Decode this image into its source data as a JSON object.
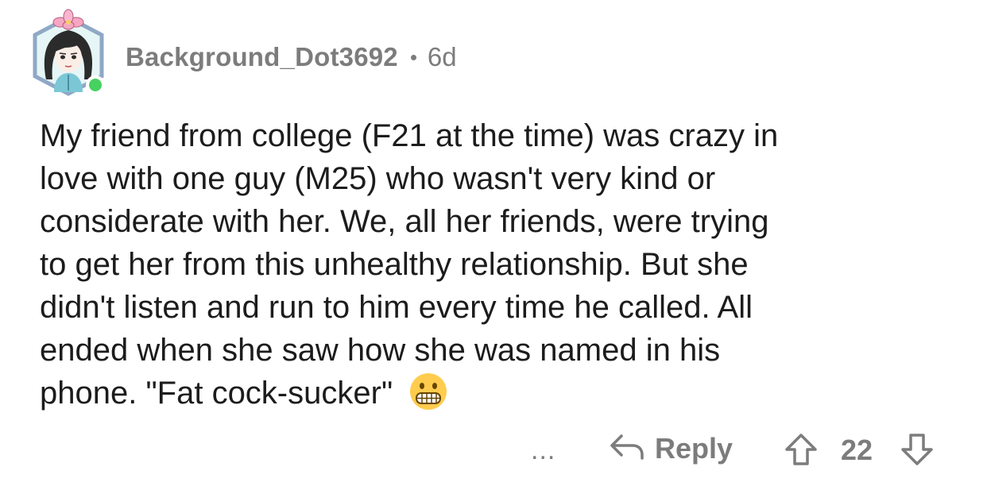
{
  "comment": {
    "author": "Background_Dot3692",
    "age": "6d",
    "lines": [
      "My friend from college (F21 at the time) was crazy in",
      "love with one guy (M25) who wasn't very kind or",
      "considerate with her. We, all her friends, were trying",
      "to get her from this unhealthy relationship. But she",
      "didn't listen and run to him every time he called. All",
      "ended when she saw how she was named in his",
      "phone. \"Fat cock-sucker\""
    ],
    "emoji": "grimacing-face"
  },
  "actions": {
    "more_label": "...",
    "reply_label": "Reply",
    "score": "22"
  },
  "colors": {
    "text": "#1c1c1c",
    "meta": "#7c7c7c",
    "online": "#46d160",
    "avatar_border": "#8fa8c6",
    "avatar_bg": "#e6f6f6"
  }
}
